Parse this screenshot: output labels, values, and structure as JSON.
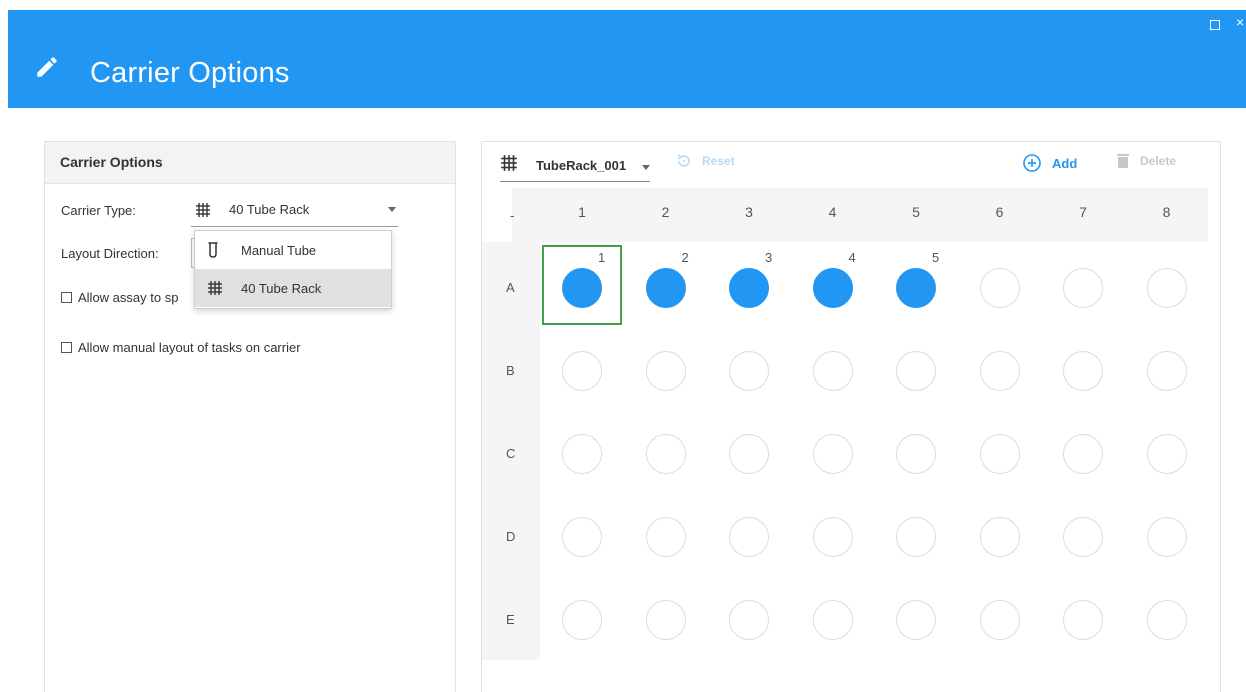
{
  "window": {
    "title": "Carrier Options",
    "title_icon": "pencil-icon",
    "accent_color": "#2196f3",
    "controls": {
      "maximize": "□",
      "close": "×"
    }
  },
  "left_panel": {
    "header": "Carrier Options",
    "carrier_type_label": "Carrier Type:",
    "carrier_type_value": "40 Tube Rack",
    "layout_direction_label": "Layout Direction:",
    "allow_assay_label": "Allow assay to sp",
    "allow_manual_label": "Allow manual layout of tasks on carrier",
    "dropdown_options": [
      {
        "label": "Manual Tube",
        "icon": "tube-icon",
        "selected": false
      },
      {
        "label": "40 Tube Rack",
        "icon": "grid-icon",
        "selected": true
      }
    ]
  },
  "right_panel": {
    "rack_name": "TubeRack_001",
    "reset_label": "Reset",
    "add_label": "Add",
    "delete_label": "Delete",
    "corner_label": "-",
    "columns": [
      "1",
      "2",
      "3",
      "4",
      "5",
      "6",
      "7",
      "8"
    ],
    "rows": [
      "A",
      "B",
      "C",
      "D",
      "E"
    ],
    "filled_wells": [
      {
        "row": "A",
        "col": "1",
        "label": "1"
      },
      {
        "row": "A",
        "col": "2",
        "label": "2"
      },
      {
        "row": "A",
        "col": "3",
        "label": "3"
      },
      {
        "row": "A",
        "col": "4",
        "label": "4"
      },
      {
        "row": "A",
        "col": "5",
        "label": "5"
      }
    ],
    "selected_well": {
      "row": "A",
      "col": "1"
    },
    "fill_color": "#2196f3",
    "selection_color": "#43a047"
  }
}
